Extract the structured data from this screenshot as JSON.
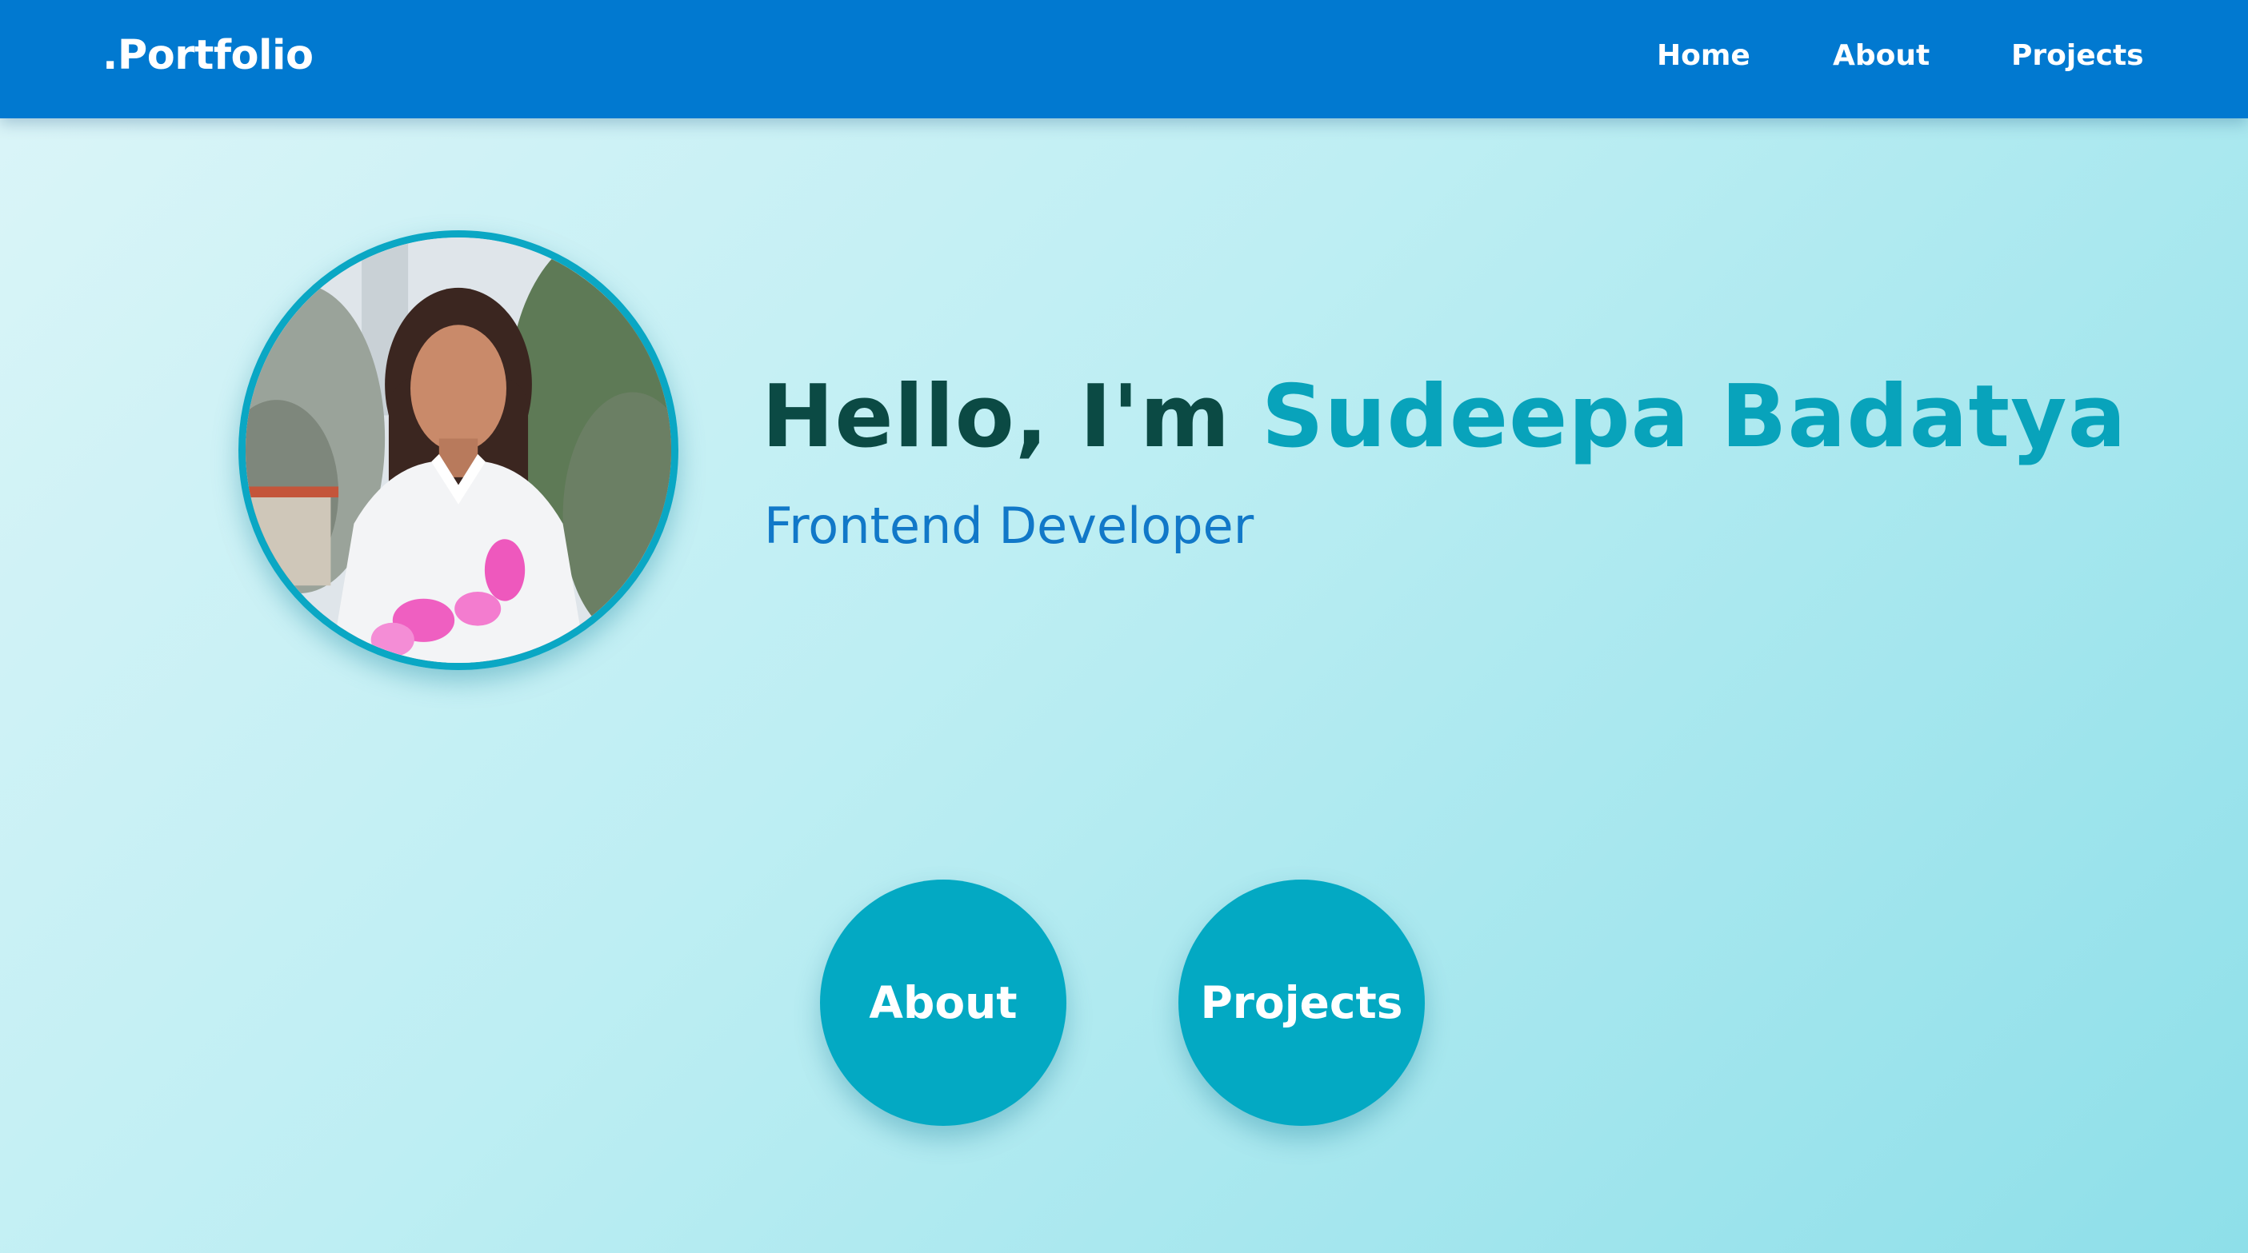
{
  "navbar": {
    "brand": ".Portfolio",
    "links": [
      {
        "label": "Home"
      },
      {
        "label": "About"
      },
      {
        "label": "Projects"
      }
    ],
    "background_color": "#0179d0"
  },
  "hero": {
    "greeting_prefix": "Hello, I'm ",
    "name": "Sudeepa Badatya",
    "role": "Frontend Developer",
    "photo_alt": "profile-photo",
    "colors": {
      "prefix": "#0b4a44",
      "name": "#08a3bb",
      "role": "#1178c8",
      "ring": "#0aa7c4"
    }
  },
  "buttons": [
    {
      "label": "About"
    },
    {
      "label": "Projects"
    }
  ],
  "theme": {
    "button_color": "#03a9c3",
    "background_gradient": [
      "#dcf5f8",
      "#bdeef3",
      "#8edfe9"
    ]
  }
}
